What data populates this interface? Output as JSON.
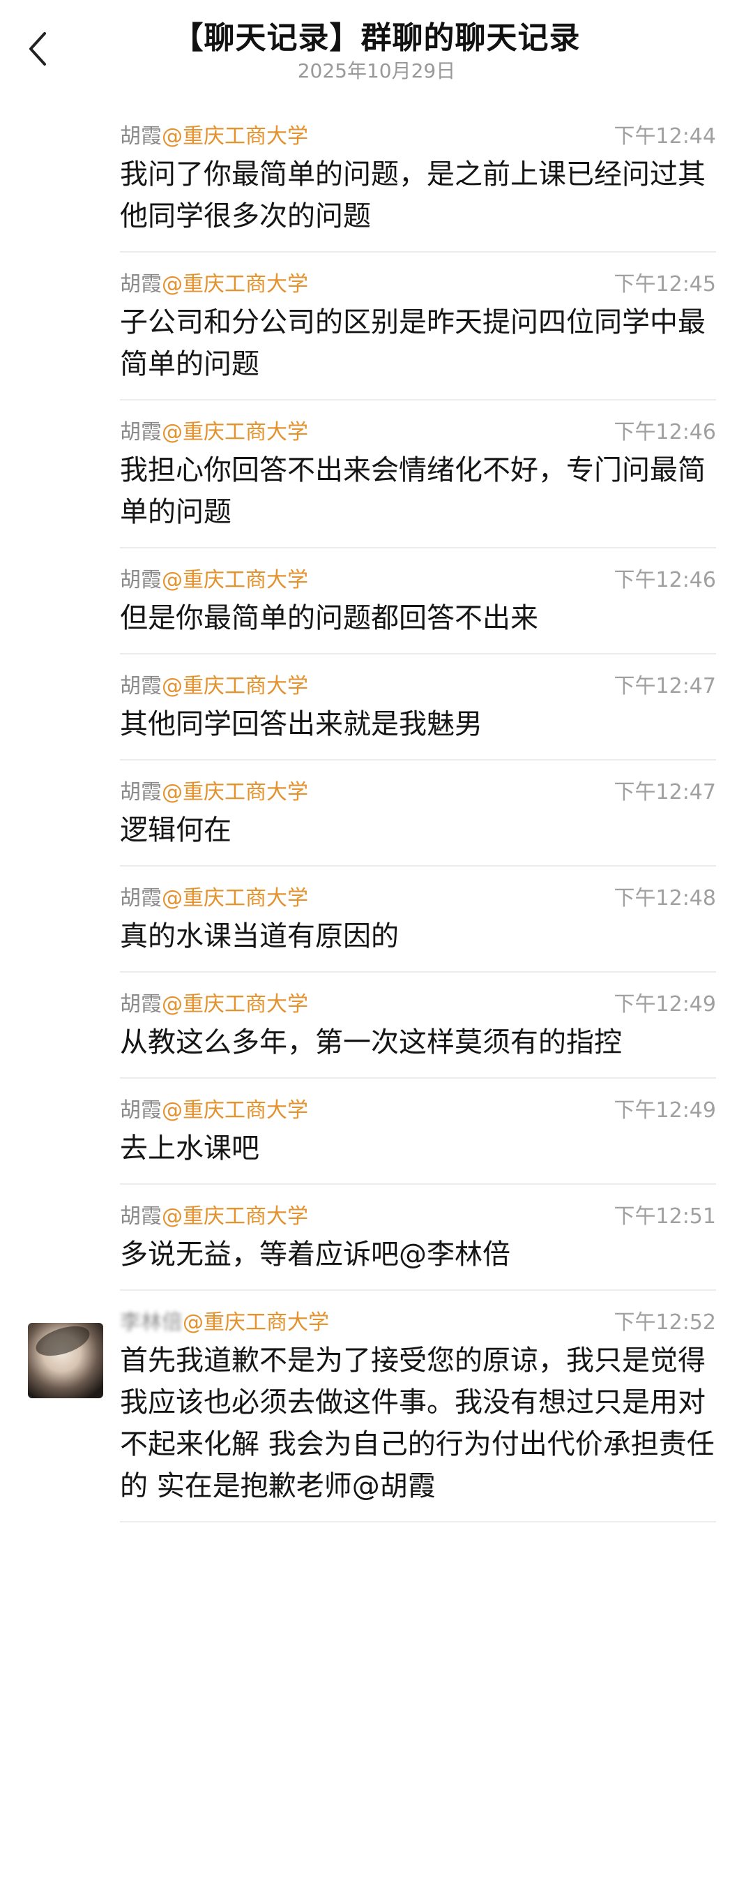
{
  "header": {
    "title": "【聊天记录】群聊的聊天记录",
    "date": "2025年10月29日"
  },
  "icons": {
    "back": "chevron-left-icon",
    "avatar": "user-avatar"
  },
  "colors": {
    "org_highlight": "#e3922e",
    "timestamp": "#a0a0a0",
    "divider": "#ececec"
  },
  "messages": [
    {
      "name": "胡霞",
      "org": "@重庆工商大学",
      "time": "下午12:44",
      "text": "我问了你最简单的问题，是之前上课已经问过其他同学很多次的问题"
    },
    {
      "name": "胡霞",
      "org": "@重庆工商大学",
      "time": "下午12:45",
      "text": "子公司和分公司的区别是昨天提问四位同学中最简单的问题"
    },
    {
      "name": "胡霞",
      "org": "@重庆工商大学",
      "time": "下午12:46",
      "text": "我担心你回答不出来会情绪化不好，专门问最简单的问题"
    },
    {
      "name": "胡霞",
      "org": "@重庆工商大学",
      "time": "下午12:46",
      "text": "但是你最简单的问题都回答不出来"
    },
    {
      "name": "胡霞",
      "org": "@重庆工商大学",
      "time": "下午12:47",
      "text": "其他同学回答出来就是我魅男"
    },
    {
      "name": "胡霞",
      "org": "@重庆工商大学",
      "time": "下午12:47",
      "text": "逻辑何在"
    },
    {
      "name": "胡霞",
      "org": "@重庆工商大学",
      "time": "下午12:48",
      "text": "真的水课当道有原因的"
    },
    {
      "name": "胡霞",
      "org": "@重庆工商大学",
      "time": "下午12:49",
      "text": "从教这么多年，第一次这样莫须有的指控"
    },
    {
      "name": "胡霞",
      "org": "@重庆工商大学",
      "time": "下午12:49",
      "text": "去上水课吧"
    },
    {
      "name": "胡霞",
      "org": "@重庆工商大学",
      "time": "下午12:51",
      "text": "多说无益，等着应诉吧@李林倍"
    },
    {
      "name": "李林倍",
      "org": "@重庆工商大学",
      "time": "下午12:52",
      "text": "首先我道歉不是为了接受您的原谅，我只是觉得我应该也必须去做这件事。我没有想过只是用对不起来化解 我会为自己的行为付出代价承担责任的 实在是抱歉老师@胡霞"
    }
  ]
}
